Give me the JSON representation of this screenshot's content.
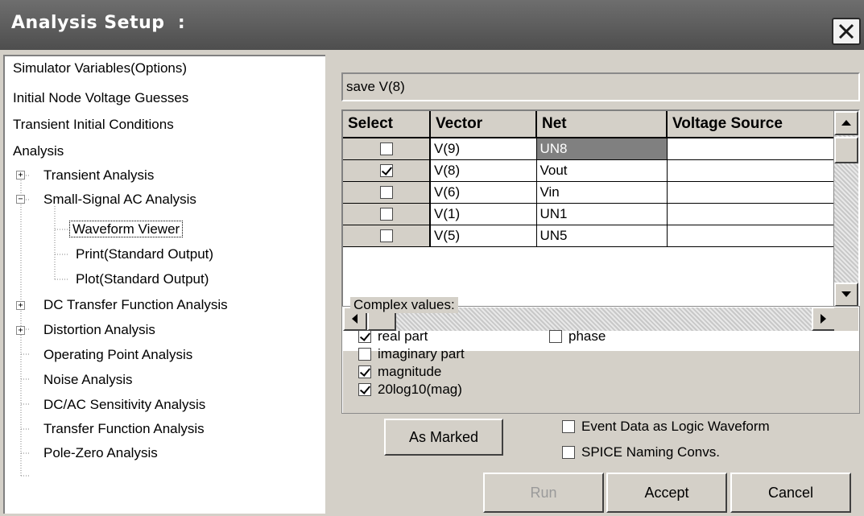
{
  "window": {
    "title": "Analysis Setup  :"
  },
  "tree": {
    "items": [
      {
        "label": "Simulator Variables(Options)"
      },
      {
        "label": "Initial Node Voltage Guesses"
      },
      {
        "label": "Transient Initial Conditions"
      },
      {
        "label": "Analysis"
      },
      {
        "label": "Transient Analysis",
        "expander": "+"
      },
      {
        "label": "Small-Signal AC Analysis",
        "expander": "−"
      },
      {
        "label": "Waveform Viewer",
        "selected": true
      },
      {
        "label": "Print(Standard Output)"
      },
      {
        "label": "Plot(Standard Output)"
      },
      {
        "label": "DC Transfer Function Analysis",
        "expander": "+"
      },
      {
        "label": "Distortion Analysis",
        "expander": "+"
      },
      {
        "label": "Operating Point Analysis"
      },
      {
        "label": "Noise Analysis"
      },
      {
        "label": "DC/AC Sensitivity Analysis"
      },
      {
        "label": "Transfer Function Analysis"
      },
      {
        "label": "Pole-Zero Analysis"
      }
    ]
  },
  "save_text": "save V(8)",
  "grid": {
    "headers": [
      "Select",
      "Vector",
      "Net",
      "Voltage Source"
    ],
    "rows": [
      {
        "checked": false,
        "vector": "V(9)",
        "net": "UN8",
        "source": ""
      },
      {
        "checked": true,
        "vector": "V(8)",
        "net": "Vout",
        "source": ""
      },
      {
        "checked": false,
        "vector": "V(6)",
        "net": "Vin",
        "source": ""
      },
      {
        "checked": false,
        "vector": "V(1)",
        "net": "UN1",
        "source": ""
      },
      {
        "checked": false,
        "vector": "V(5)",
        "net": "UN5",
        "source": ""
      }
    ]
  },
  "complex": {
    "label": "Complex values:",
    "real": {
      "label": "real part",
      "checked": true
    },
    "imaginary": {
      "label": "imaginary part",
      "checked": false
    },
    "magnitude": {
      "label": "magnitude",
      "checked": true
    },
    "db": {
      "label": "20log10(mag)",
      "checked": true
    },
    "phase": {
      "label": "phase",
      "checked": false
    }
  },
  "options": {
    "event_data": {
      "label": "Event Data as Logic Waveform",
      "checked": false
    },
    "spice_naming": {
      "label": "SPICE Naming Convs.",
      "checked": false
    }
  },
  "buttons": {
    "as_marked": "As Marked",
    "run": "Run",
    "accept": "Accept",
    "cancel": "Cancel"
  }
}
